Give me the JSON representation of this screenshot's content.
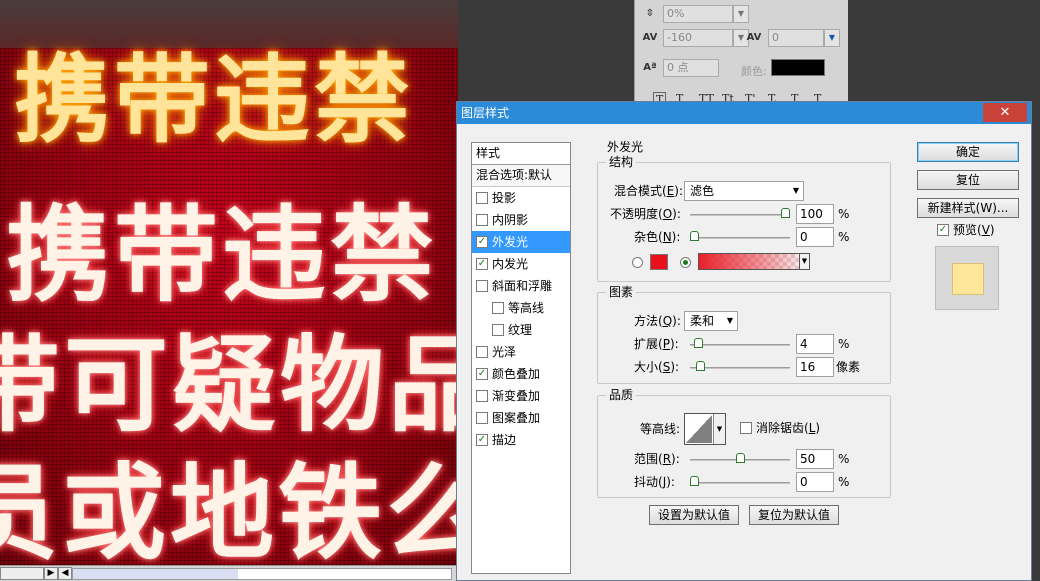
{
  "canvas": {
    "line1": "携带违禁",
    "line2": "携带违禁",
    "line3": "带可疑物品",
    "line4": "员或地铁么"
  },
  "character_panel": {
    "row1_value": "0%",
    "row2_tracking_value": "-160",
    "row2_kerning_value": "0",
    "row3_baseline_value": "0 点",
    "color_label": "颜色:",
    "color_value": "#000000",
    "style_buttons": [
      "T",
      "T",
      "TT",
      "Tt",
      "T'",
      "T,",
      "T",
      "T"
    ]
  },
  "dialog": {
    "title": "图层样式",
    "close": "✕",
    "styles_header": "样式",
    "blend_options": "混合选项:默认",
    "style_items": [
      {
        "label": "投影",
        "checked": false,
        "indent": false
      },
      {
        "label": "内阴影",
        "checked": false,
        "indent": false
      },
      {
        "label": "外发光",
        "checked": true,
        "indent": false,
        "selected": true
      },
      {
        "label": "内发光",
        "checked": true,
        "indent": false
      },
      {
        "label": "斜面和浮雕",
        "checked": false,
        "indent": false
      },
      {
        "label": "等高线",
        "checked": false,
        "indent": true
      },
      {
        "label": "纹理",
        "checked": false,
        "indent": true
      },
      {
        "label": "光泽",
        "checked": false,
        "indent": false
      },
      {
        "label": "颜色叠加",
        "checked": true,
        "indent": false
      },
      {
        "label": "渐变叠加",
        "checked": false,
        "indent": false
      },
      {
        "label": "图案叠加",
        "checked": false,
        "indent": false
      },
      {
        "label": "描边",
        "checked": true,
        "indent": false
      }
    ],
    "section_title": "外发光",
    "structure": {
      "title": "结构",
      "blend_mode_label": "混合模式(",
      "blend_mode_key": "E",
      "blend_mode_value": "滤色",
      "opacity_label": "不透明度(",
      "opacity_key": "O",
      "opacity_value": "100",
      "opacity_fraction": 1.0,
      "noise_label": "杂色(",
      "noise_key": "N",
      "noise_value": "0",
      "noise_fraction": 0.0,
      "unit_percent": "%",
      "glow_color": "#e8101a"
    },
    "elements": {
      "title": "图素",
      "method_label": "方法(",
      "method_key": "Q",
      "method_value": "柔和",
      "spread_label": "扩展(",
      "spread_key": "P",
      "spread_value": "4",
      "spread_fraction": 0.04,
      "size_label": "大小(",
      "size_key": "S",
      "size_value": "16",
      "size_fraction": 0.064,
      "unit_percent": "%",
      "unit_pixels": "像素"
    },
    "quality": {
      "title": "品质",
      "contour_label": "等高线:",
      "antialias_label": "消除锯齿(",
      "antialias_key": "L",
      "antialias_checked": false,
      "range_label": "范围(",
      "range_key": "R",
      "range_value": "50",
      "range_fraction": 0.5,
      "jitter_label": "抖动(",
      "jitter_key": "J",
      "jitter_value": "0",
      "jitter_fraction": 0.0,
      "unit_percent": "%"
    },
    "set_default": "设置为默认值",
    "reset_default": "复位为默认值",
    "ok": "确定",
    "reset": "复位",
    "new_style": "新建样式(W)...",
    "preview_label": "预览(",
    "preview_key": "V",
    "preview_checked": true,
    "preview_swatch_color": "#ffe79a"
  }
}
